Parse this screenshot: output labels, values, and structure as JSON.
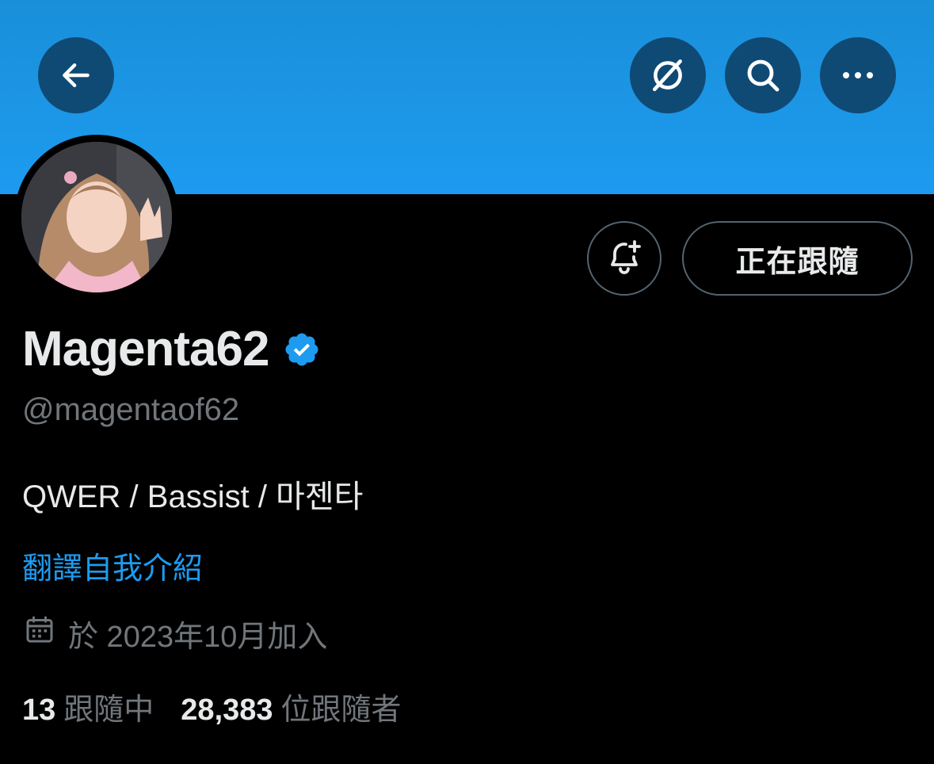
{
  "header": {
    "back_icon": "arrow-left-icon",
    "actions": [
      {
        "name": "grok-icon"
      },
      {
        "name": "search-icon"
      },
      {
        "name": "more-icon"
      }
    ],
    "banner_color": "#1d9bf0"
  },
  "profile": {
    "display_name": "Magenta62",
    "verified": true,
    "verified_color": "#1d9bf0",
    "handle": "@magentaof62",
    "bio": "QWER / Bassist / 마젠타",
    "translate_bio": "翻譯自我介紹",
    "joined": "於 2023年10月加入",
    "follow_button_label": "正在跟隨"
  },
  "stats": {
    "following_count": "13",
    "following_label": "跟隨中",
    "followers_count": "28,383",
    "followers_label": "位跟隨者"
  }
}
